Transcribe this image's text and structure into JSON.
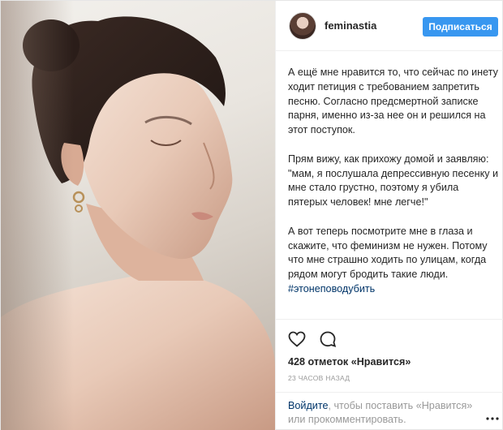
{
  "post": {
    "username": "feminastia",
    "follow_label": "Подписаться",
    "caption": {
      "paragraph1": "А ещё мне нравится то, что сейчас по инету ходит петиция с требованием запретить песню. Согласно предсмертной записке парня, именно из-за нее он и решился на этот поступок.",
      "paragraph2": "Прям вижу, как прихожу домой и заявляю: \"мам, я послушала депрессивную песенку и мне стало грустно, поэтому я убила пятерых человек! мне легче!\"",
      "paragraph3": "А вот теперь посмотрите мне в глаза и скажите, что феминизм не нужен. Потому что мне страшно ходить по улицам, когда рядом могут бродить такие люди.",
      "hashtag": "#этонеповодубить"
    },
    "likes_text": "428 отметок «Нравится»",
    "timestamp": "23 ЧАСОВ НАЗАД",
    "login_prompt": {
      "link": "Войдите",
      "text": ", чтобы поставить «Нравится» или прокомментировать."
    }
  },
  "colors": {
    "accent": "#3897f0",
    "link": "#003569",
    "muted": "#999999",
    "text": "#262626"
  },
  "icons": [
    "heart-icon",
    "comment-icon",
    "more-options-icon"
  ]
}
